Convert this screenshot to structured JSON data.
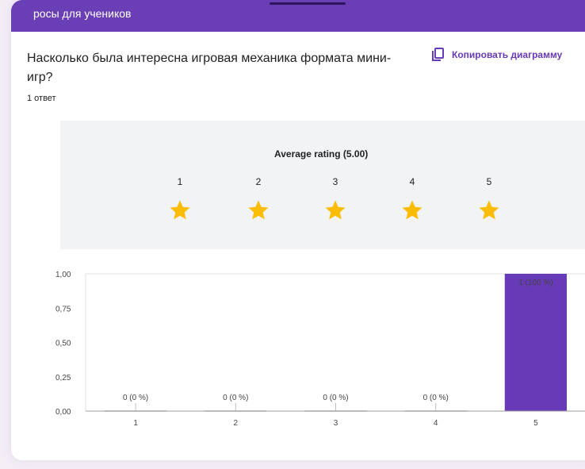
{
  "header": {
    "title": "росы для учеников"
  },
  "question": {
    "text": "Насколько была интересна игровая механика формата мини-игр?",
    "copy_label": "Копировать диаграмму",
    "response_count": "1 ответ"
  },
  "rating": {
    "average_label": "Average rating (5.00)",
    "scale": [
      "1",
      "2",
      "3",
      "4",
      "5"
    ],
    "stars_filled": 5,
    "star_color": "#fbbc04"
  },
  "colors": {
    "accent": "#673ab7",
    "header": "#6a3fb5",
    "bar": "#673ab7"
  },
  "chart_data": {
    "type": "bar",
    "categories": [
      "1",
      "2",
      "3",
      "4",
      "5"
    ],
    "values": [
      0,
      0,
      0,
      0,
      1
    ],
    "data_labels": [
      "0 (0 %)",
      "0 (0 %)",
      "0 (0 %)",
      "0 (0 %)",
      "1 (100 %)"
    ],
    "y_ticks": [
      "0,00",
      "0,25",
      "0,50",
      "0,75",
      "1,00"
    ],
    "ylim": [
      0,
      1
    ],
    "grid": true
  }
}
